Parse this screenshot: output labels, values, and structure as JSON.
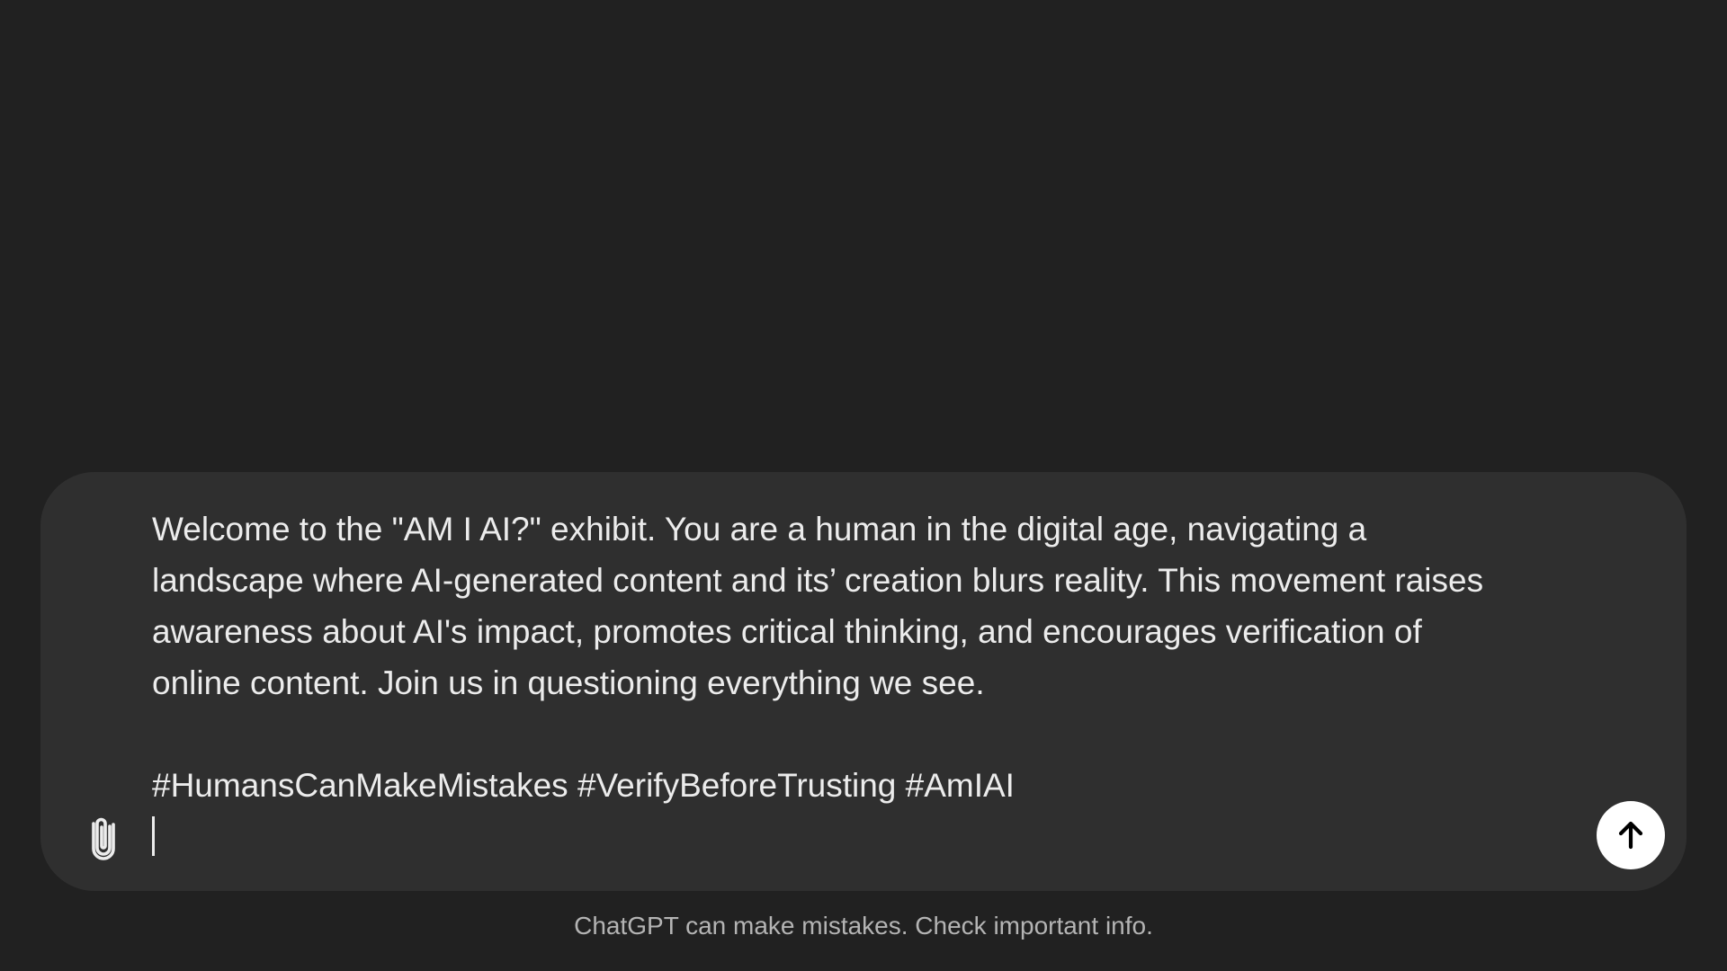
{
  "composer": {
    "paragraph_lines": [
      "Welcome to the \"AM I AI?\" exhibit. You are a human in the digital age, navigating a",
      "landscape where AI-generated content and its’ creation blurs reality. This movement raises",
      "awareness about AI's impact, promotes critical thinking, and encourages verification of",
      "online content. Join us in questioning everything we see."
    ],
    "hashtags": "#HumansCanMakeMistakes #VerifyBeforeTrusting #AmIAI",
    "attach_icon": "paperclip-icon",
    "send_icon": "arrow-up-icon"
  },
  "footer": {
    "disclaimer": "ChatGPT can make mistakes. Check important info."
  },
  "colors": {
    "background": "#212121",
    "composer": "#2f2f2f",
    "text": "#ececec",
    "muted": "#b4b4b4",
    "send_button": "#ffffff"
  }
}
